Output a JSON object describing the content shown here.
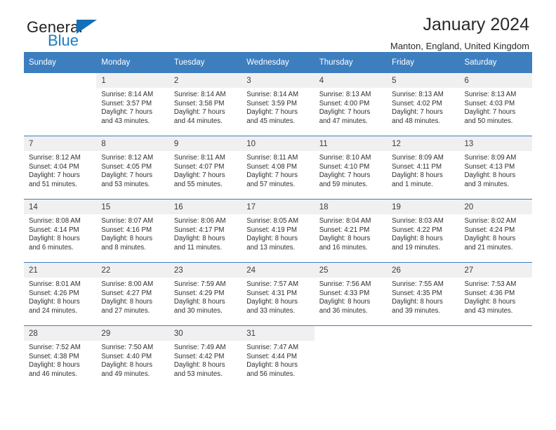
{
  "brand": {
    "name_dark": "General",
    "name_blue": "Blue",
    "triangle_icon": "triangle-icon",
    "accent_color": "#136fb7",
    "blue_text_color": "#1b7fc4"
  },
  "header": {
    "title": "January 2024",
    "subtitle": "Manton, England, United Kingdom"
  },
  "calendar": {
    "header_bg_color": "#3d7ebf",
    "daynum_bg_color": "#f0f0f0",
    "weekdays": [
      "Sunday",
      "Monday",
      "Tuesday",
      "Wednesday",
      "Thursday",
      "Friday",
      "Saturday"
    ],
    "weeks": [
      [
        {
          "day": "",
          "sunrise": "",
          "sunset": "",
          "daylight_line1": "",
          "daylight_line2": ""
        },
        {
          "day": "1",
          "sunrise": "Sunrise: 8:14 AM",
          "sunset": "Sunset: 3:57 PM",
          "daylight_line1": "Daylight: 7 hours",
          "daylight_line2": "and 43 minutes."
        },
        {
          "day": "2",
          "sunrise": "Sunrise: 8:14 AM",
          "sunset": "Sunset: 3:58 PM",
          "daylight_line1": "Daylight: 7 hours",
          "daylight_line2": "and 44 minutes."
        },
        {
          "day": "3",
          "sunrise": "Sunrise: 8:14 AM",
          "sunset": "Sunset: 3:59 PM",
          "daylight_line1": "Daylight: 7 hours",
          "daylight_line2": "and 45 minutes."
        },
        {
          "day": "4",
          "sunrise": "Sunrise: 8:13 AM",
          "sunset": "Sunset: 4:00 PM",
          "daylight_line1": "Daylight: 7 hours",
          "daylight_line2": "and 47 minutes."
        },
        {
          "day": "5",
          "sunrise": "Sunrise: 8:13 AM",
          "sunset": "Sunset: 4:02 PM",
          "daylight_line1": "Daylight: 7 hours",
          "daylight_line2": "and 48 minutes."
        },
        {
          "day": "6",
          "sunrise": "Sunrise: 8:13 AM",
          "sunset": "Sunset: 4:03 PM",
          "daylight_line1": "Daylight: 7 hours",
          "daylight_line2": "and 50 minutes."
        }
      ],
      [
        {
          "day": "7",
          "sunrise": "Sunrise: 8:12 AM",
          "sunset": "Sunset: 4:04 PM",
          "daylight_line1": "Daylight: 7 hours",
          "daylight_line2": "and 51 minutes."
        },
        {
          "day": "8",
          "sunrise": "Sunrise: 8:12 AM",
          "sunset": "Sunset: 4:05 PM",
          "daylight_line1": "Daylight: 7 hours",
          "daylight_line2": "and 53 minutes."
        },
        {
          "day": "9",
          "sunrise": "Sunrise: 8:11 AM",
          "sunset": "Sunset: 4:07 PM",
          "daylight_line1": "Daylight: 7 hours",
          "daylight_line2": "and 55 minutes."
        },
        {
          "day": "10",
          "sunrise": "Sunrise: 8:11 AM",
          "sunset": "Sunset: 4:08 PM",
          "daylight_line1": "Daylight: 7 hours",
          "daylight_line2": "and 57 minutes."
        },
        {
          "day": "11",
          "sunrise": "Sunrise: 8:10 AM",
          "sunset": "Sunset: 4:10 PM",
          "daylight_line1": "Daylight: 7 hours",
          "daylight_line2": "and 59 minutes."
        },
        {
          "day": "12",
          "sunrise": "Sunrise: 8:09 AM",
          "sunset": "Sunset: 4:11 PM",
          "daylight_line1": "Daylight: 8 hours",
          "daylight_line2": "and 1 minute."
        },
        {
          "day": "13",
          "sunrise": "Sunrise: 8:09 AM",
          "sunset": "Sunset: 4:13 PM",
          "daylight_line1": "Daylight: 8 hours",
          "daylight_line2": "and 3 minutes."
        }
      ],
      [
        {
          "day": "14",
          "sunrise": "Sunrise: 8:08 AM",
          "sunset": "Sunset: 4:14 PM",
          "daylight_line1": "Daylight: 8 hours",
          "daylight_line2": "and 6 minutes."
        },
        {
          "day": "15",
          "sunrise": "Sunrise: 8:07 AM",
          "sunset": "Sunset: 4:16 PM",
          "daylight_line1": "Daylight: 8 hours",
          "daylight_line2": "and 8 minutes."
        },
        {
          "day": "16",
          "sunrise": "Sunrise: 8:06 AM",
          "sunset": "Sunset: 4:17 PM",
          "daylight_line1": "Daylight: 8 hours",
          "daylight_line2": "and 11 minutes."
        },
        {
          "day": "17",
          "sunrise": "Sunrise: 8:05 AM",
          "sunset": "Sunset: 4:19 PM",
          "daylight_line1": "Daylight: 8 hours",
          "daylight_line2": "and 13 minutes."
        },
        {
          "day": "18",
          "sunrise": "Sunrise: 8:04 AM",
          "sunset": "Sunset: 4:21 PM",
          "daylight_line1": "Daylight: 8 hours",
          "daylight_line2": "and 16 minutes."
        },
        {
          "day": "19",
          "sunrise": "Sunrise: 8:03 AM",
          "sunset": "Sunset: 4:22 PM",
          "daylight_line1": "Daylight: 8 hours",
          "daylight_line2": "and 19 minutes."
        },
        {
          "day": "20",
          "sunrise": "Sunrise: 8:02 AM",
          "sunset": "Sunset: 4:24 PM",
          "daylight_line1": "Daylight: 8 hours",
          "daylight_line2": "and 21 minutes."
        }
      ],
      [
        {
          "day": "21",
          "sunrise": "Sunrise: 8:01 AM",
          "sunset": "Sunset: 4:26 PM",
          "daylight_line1": "Daylight: 8 hours",
          "daylight_line2": "and 24 minutes."
        },
        {
          "day": "22",
          "sunrise": "Sunrise: 8:00 AM",
          "sunset": "Sunset: 4:27 PM",
          "daylight_line1": "Daylight: 8 hours",
          "daylight_line2": "and 27 minutes."
        },
        {
          "day": "23",
          "sunrise": "Sunrise: 7:59 AM",
          "sunset": "Sunset: 4:29 PM",
          "daylight_line1": "Daylight: 8 hours",
          "daylight_line2": "and 30 minutes."
        },
        {
          "day": "24",
          "sunrise": "Sunrise: 7:57 AM",
          "sunset": "Sunset: 4:31 PM",
          "daylight_line1": "Daylight: 8 hours",
          "daylight_line2": "and 33 minutes."
        },
        {
          "day": "25",
          "sunrise": "Sunrise: 7:56 AM",
          "sunset": "Sunset: 4:33 PM",
          "daylight_line1": "Daylight: 8 hours",
          "daylight_line2": "and 36 minutes."
        },
        {
          "day": "26",
          "sunrise": "Sunrise: 7:55 AM",
          "sunset": "Sunset: 4:35 PM",
          "daylight_line1": "Daylight: 8 hours",
          "daylight_line2": "and 39 minutes."
        },
        {
          "day": "27",
          "sunrise": "Sunrise: 7:53 AM",
          "sunset": "Sunset: 4:36 PM",
          "daylight_line1": "Daylight: 8 hours",
          "daylight_line2": "and 43 minutes."
        }
      ],
      [
        {
          "day": "28",
          "sunrise": "Sunrise: 7:52 AM",
          "sunset": "Sunset: 4:38 PM",
          "daylight_line1": "Daylight: 8 hours",
          "daylight_line2": "and 46 minutes."
        },
        {
          "day": "29",
          "sunrise": "Sunrise: 7:50 AM",
          "sunset": "Sunset: 4:40 PM",
          "daylight_line1": "Daylight: 8 hours",
          "daylight_line2": "and 49 minutes."
        },
        {
          "day": "30",
          "sunrise": "Sunrise: 7:49 AM",
          "sunset": "Sunset: 4:42 PM",
          "daylight_line1": "Daylight: 8 hours",
          "daylight_line2": "and 53 minutes."
        },
        {
          "day": "31",
          "sunrise": "Sunrise: 7:47 AM",
          "sunset": "Sunset: 4:44 PM",
          "daylight_line1": "Daylight: 8 hours",
          "daylight_line2": "and 56 minutes."
        },
        {
          "day": "",
          "sunrise": "",
          "sunset": "",
          "daylight_line1": "",
          "daylight_line2": ""
        },
        {
          "day": "",
          "sunrise": "",
          "sunset": "",
          "daylight_line1": "",
          "daylight_line2": ""
        },
        {
          "day": "",
          "sunrise": "",
          "sunset": "",
          "daylight_line1": "",
          "daylight_line2": ""
        }
      ]
    ]
  }
}
